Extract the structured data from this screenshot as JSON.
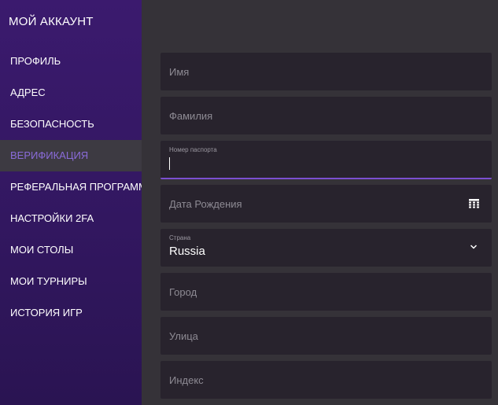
{
  "sidebar": {
    "title": "МОЙ АККАУНТ",
    "items": [
      {
        "label": "ПРОФИЛЬ",
        "active": false
      },
      {
        "label": "АДРЕС",
        "active": false
      },
      {
        "label": "БЕЗОПАСНОСТЬ",
        "active": false
      },
      {
        "label": "ВЕРИФИКАЦИЯ",
        "active": true
      },
      {
        "label": "РЕФЕРАЛЬНАЯ ПРОГРАММА",
        "active": false
      },
      {
        "label": "НАСТРОЙКИ 2FA",
        "active": false
      },
      {
        "label": "МОИ СТОЛЫ",
        "active": false
      },
      {
        "label": "МОИ ТУРНИРЫ",
        "active": false
      },
      {
        "label": "ИСТОРИЯ ИГР",
        "active": false
      }
    ]
  },
  "form": {
    "first_name": {
      "placeholder": "Имя",
      "value": ""
    },
    "last_name": {
      "placeholder": "Фамилия",
      "value": ""
    },
    "passport": {
      "label": "Номер паспорта",
      "value": ""
    },
    "birth_date": {
      "placeholder": "Дата Рождения",
      "value": "",
      "icon": "calendar-icon"
    },
    "country": {
      "label": "Страна",
      "value": "Russia",
      "icon": "chevron-down-icon"
    },
    "city": {
      "placeholder": "Город",
      "value": ""
    },
    "street": {
      "placeholder": "Улица",
      "value": ""
    },
    "postal_code": {
      "placeholder": "Индекс",
      "value": ""
    }
  },
  "colors": {
    "accent": "#7b4fd0",
    "active_nav_text": "#8a6bd9",
    "sidebar_bg": "#3b1a6e",
    "field_bg": "#28232d",
    "page_bg": "#353238"
  }
}
